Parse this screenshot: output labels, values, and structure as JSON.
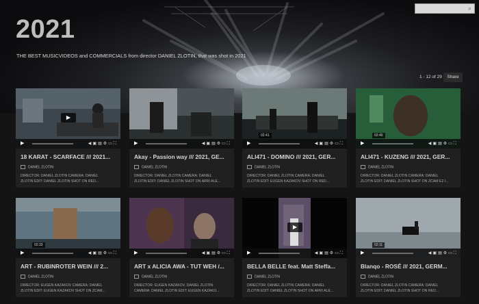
{
  "header": {
    "title": "2021",
    "subtitle": "THE BEST MUSICVIDEOS and COMMERCIALS from director DANIEL ZLOTIN, that was shot in 2021",
    "search_placeholder": "",
    "pagination": "1 - 12 of 29",
    "share_label": "Share"
  },
  "videos": [
    {
      "title": "18 KARAT - SCARFACE /// 2021...",
      "author": "DANIEL ZLOTIN",
      "desc1": "DIRECTOR: DANIEL ZLOTIN CAMERA: DANIEL",
      "desc2": "ZLOTIN EDIT: DANIEL ZLOTIN SHOT ON RED...",
      "time": ""
    },
    {
      "title": "Akay - Passion way /// 2021, GE...",
      "author": "DANIEL ZLOTIN",
      "desc1": "DIRECTOR: DANIEL ZLOTIN CAMERA: DANIEL",
      "desc2": "ZLOTIN EDIT: DANIEL ZLOTIN SHOT ON ARRI ALE...",
      "time": ""
    },
    {
      "title": "ALI471 - DOMINO /// 2021, GER...",
      "author": "DANIEL ZLOTIN",
      "desc1": "DIRECTOR: DANIEL ZLOTIN CAMERA: DANIEL",
      "desc2": "ZLOTIN EDIT: EUGEN KAZAKOV SHOT ON RED...",
      "time": "02:41"
    },
    {
      "title": "ALI471 - KUZENG /// 2021, GER...",
      "author": "DANIEL ZLOTIN",
      "desc1": "DIRECTOR: DANIEL ZLOTIN CAMERA: DANIEL",
      "desc2": "ZLOTIN EDIT: DANIEL ZLOTIN SHOT ON ZCAM E2 I...",
      "time": "02:40"
    },
    {
      "title": "ART - RUBINROTER WEIN /// 2...",
      "author": "DANIEL ZLOTIN",
      "desc1": "DIRECTOR: EUGEN KAZAKOV CAMERA: DANIEL",
      "desc2": "ZLOTIN EDIT: EUGEN KAZAKOV SHOT ON ZCAM...",
      "time": "02:33"
    },
    {
      "title": "ART x ALICIA AWA - TUT WEH /...",
      "author": "DANIEL ZLOTIN",
      "desc1": "DIRECTOR: EUGEN KAZAKOV, DANIEL ZLOTIN",
      "desc2": "CAMERA: DANIEL ZLOTIN EDIT: EUGEN KAZAKO...",
      "time": ""
    },
    {
      "title": "BELLA BELLE feat. Matt Steffa...",
      "author": "DANIEL ZLOTIN",
      "desc1": "DIRECTOR: DANIEL ZLOTIN CAMERA: DANIEL",
      "desc2": "ZLOTIN EDIT: DANIEL ZLOTIN SHOT ON ARRI ALE...",
      "time": ""
    },
    {
      "title": "Blanqo - ROSÉ /// 2021, GERM...",
      "author": "DANIEL ZLOTIN",
      "desc1": "DIRECTOR: DANIEL ZLOTIN CAMERA: DANIEL",
      "desc2": "ZLOTIN EDIT: DANIEL ZLOTIN SHOT ON RED...",
      "time": "02:11"
    }
  ],
  "icons": {
    "play": "play-icon",
    "search": "search-icon",
    "author": "author-icon",
    "controls": [
      "volume-icon",
      "captions-icon",
      "chapters-icon",
      "settings-icon",
      "pip-icon",
      "fullscreen-icon"
    ]
  }
}
